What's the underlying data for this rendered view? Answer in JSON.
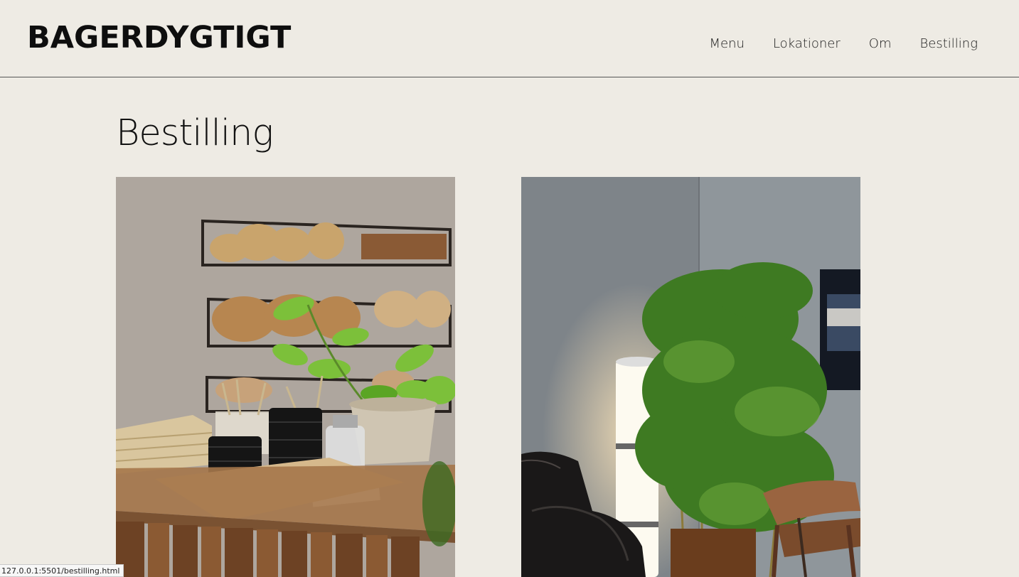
{
  "brand": {
    "logo_text": "BAGERDYGTIGT"
  },
  "nav": {
    "items": [
      {
        "label": "Menu"
      },
      {
        "label": "Lokationer"
      },
      {
        "label": "Om"
      },
      {
        "label": "Bestilling"
      }
    ]
  },
  "main": {
    "title": "Bestilling",
    "images": [
      {
        "name": "bakery-counter-photo"
      },
      {
        "name": "lounge-corner-photo"
      }
    ]
  },
  "status_bar": {
    "url": "127.0.0.1:5501/bestilling.html"
  },
  "colors": {
    "background": "#eeebe4",
    "text": "#111111",
    "divider": "#555555"
  }
}
